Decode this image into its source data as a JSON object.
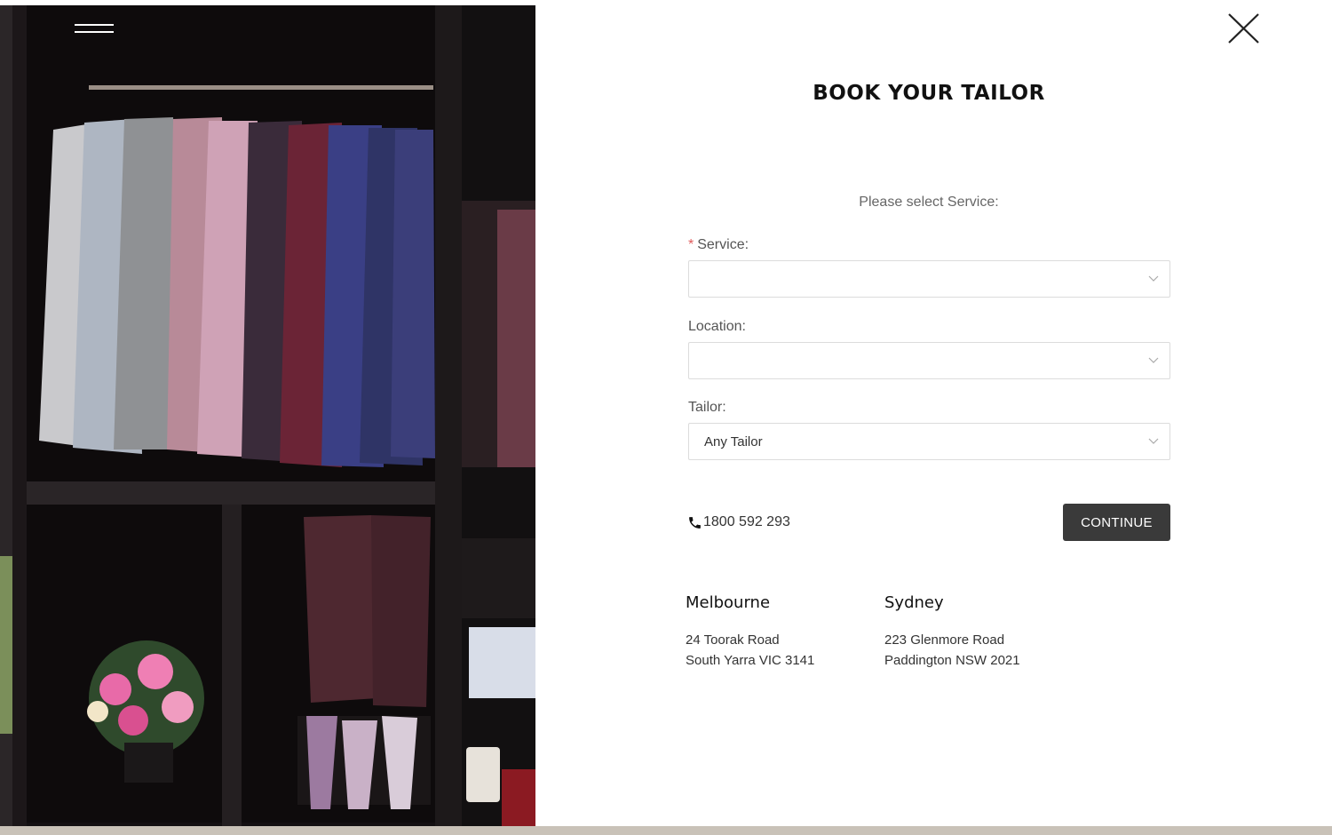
{
  "header": {
    "menu_icon": "hamburger-menu-icon",
    "close_icon": "close-x-icon"
  },
  "booking": {
    "title": "BOOK YOUR TAILOR",
    "subtitle": "Please select Service:",
    "service": {
      "required_mark": "*",
      "label": "Service:",
      "value": ""
    },
    "location": {
      "label": "Location:",
      "value": ""
    },
    "tailor": {
      "label": "Tailor:",
      "value": "Any Tailor"
    },
    "phone": {
      "icon": "phone-icon",
      "number": "1800 592 293"
    },
    "continue_label": "CONTINUE"
  },
  "locations": [
    {
      "city": "Melbourne",
      "address_line1": "24 Toorak Road",
      "address_line2": "South Yarra VIC 3141"
    },
    {
      "city": "Sydney",
      "address_line1": "223 Glenmore Road",
      "address_line2": "Paddington NSW 2021"
    }
  ],
  "colors": {
    "button_bg": "#3a3a3a",
    "required": "#e05b5b",
    "border": "#dcdcdc"
  }
}
